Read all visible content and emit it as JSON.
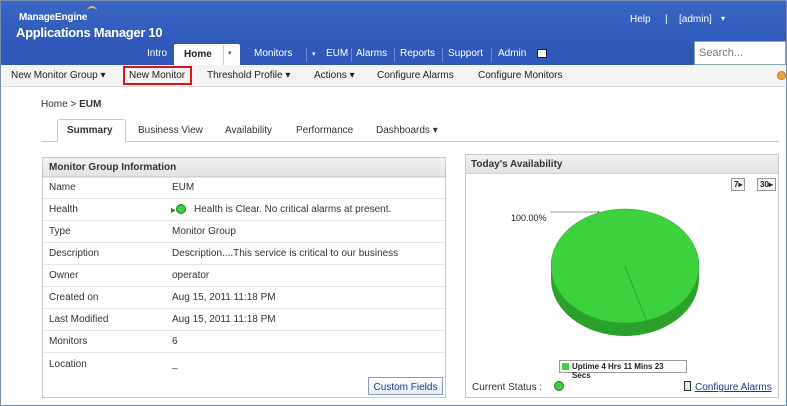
{
  "header": {
    "logo_top": "ManageEngine",
    "logo_bottom": "Applications Manager 10",
    "help": "Help",
    "pipe": "|",
    "user": "[admin]",
    "user_caret": "▾"
  },
  "nav": {
    "intro": "Intro",
    "home": "Home",
    "home_caret": "▾",
    "monitors": "Monitors",
    "monitors_caret": "▾",
    "eum": "EUM",
    "alarms": "Alarms",
    "reports": "Reports",
    "support": "Support",
    "admin": "Admin",
    "search_placeholder": "Search..."
  },
  "toolbar": {
    "new_monitor_group": "New Monitor Group ▾",
    "new_monitor": "New Monitor",
    "threshold_profile": "Threshold Profile ▾",
    "actions": "Actions ▾",
    "configure_alarms": "Configure Alarms",
    "configure_monitors": "Configure Monitors"
  },
  "breadcrumb": {
    "home": "Home",
    "sep": ">",
    "current": "EUM"
  },
  "tabs": {
    "summary": "Summary",
    "business_view": "Business View",
    "availability": "Availability",
    "performance": "Performance",
    "dashboards": "Dashboards ▾"
  },
  "monitor_group": {
    "title": "Monitor Group Information",
    "rows": [
      {
        "label": "Name",
        "value": "EUM"
      },
      {
        "label": "Health",
        "value": "Health is Clear. No critical alarms at present."
      },
      {
        "label": "Type",
        "value": "Monitor Group"
      },
      {
        "label": "Description",
        "value": "Description....This service is critical to our business"
      },
      {
        "label": "Owner",
        "value": "operator"
      },
      {
        "label": "Created on",
        "value": "Aug 15, 2011 11:18 PM"
      },
      {
        "label": "Last Modified",
        "value": "Aug 15, 2011 11:18 PM"
      },
      {
        "label": "Monitors",
        "value": "6"
      },
      {
        "label": "Location",
        "value": "_"
      }
    ],
    "custom_fields": "Custom Fields"
  },
  "availability": {
    "title": "Today's Availability",
    "period_7": "7",
    "period_30": "30",
    "pie_label": "100.00%",
    "legend": "Uptime 4 Hrs 11 Mins 23 Secs",
    "current_status": "Current Status :",
    "configure_alarms": "Configure Alarms",
    "colors": {
      "uptime": "#3ed13e",
      "uptime_dark": "#2aa12a"
    }
  },
  "chart_data": {
    "type": "pie",
    "categories": [
      "Uptime 4 Hrs 11 Mins 23 Secs"
    ],
    "values": [
      100.0
    ],
    "title": "Today's Availability"
  }
}
